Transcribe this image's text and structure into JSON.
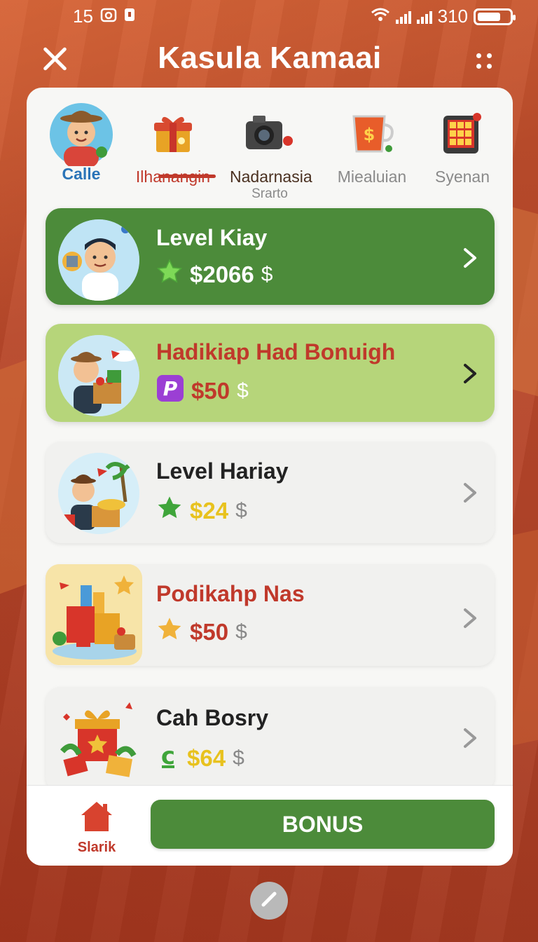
{
  "status_bar": {
    "time": "15",
    "signal_text": "310"
  },
  "header": {
    "title": "Kasula Kamaai"
  },
  "tabs": [
    {
      "label": "Calle",
      "sub": "",
      "icon": "avatar-boy"
    },
    {
      "label": "Ilhanangin",
      "sub": "",
      "icon": "gift-icon",
      "active": true
    },
    {
      "label": "Nadarnasia",
      "sub": "Srarto",
      "icon": "camera-icon"
    },
    {
      "label": "Miealuian",
      "sub": "",
      "icon": "money-mug-icon"
    },
    {
      "label": "Syenan",
      "sub": "",
      "icon": "slot-machine-icon"
    }
  ],
  "cards": [
    {
      "name": "Level Kiay",
      "amount": "$2066",
      "currency": "$",
      "badge": "star-icon"
    },
    {
      "name": "Hadikiap Had Bonuigh",
      "amount": "$50",
      "currency": "$",
      "badge": "p-app-icon"
    },
    {
      "name": "Level Hariay",
      "amount": "$24",
      "currency": "$",
      "badge": "star-icon"
    },
    {
      "name": "Podikahp Nas",
      "amount": "$50",
      "currency": "$",
      "badge": "gold-star-icon"
    },
    {
      "name": "Cah Bosry",
      "amount": "$64",
      "currency": "$",
      "badge": "cash-c-icon"
    }
  ],
  "bottom": {
    "home_label": "Slarik",
    "bonus_label": "BONUS"
  },
  "colors": {
    "primary_green": "#4c8b3a",
    "light_green": "#b6d57a",
    "accent_red": "#c0392b",
    "gold": "#e8c21e",
    "background": "#b8492a"
  }
}
